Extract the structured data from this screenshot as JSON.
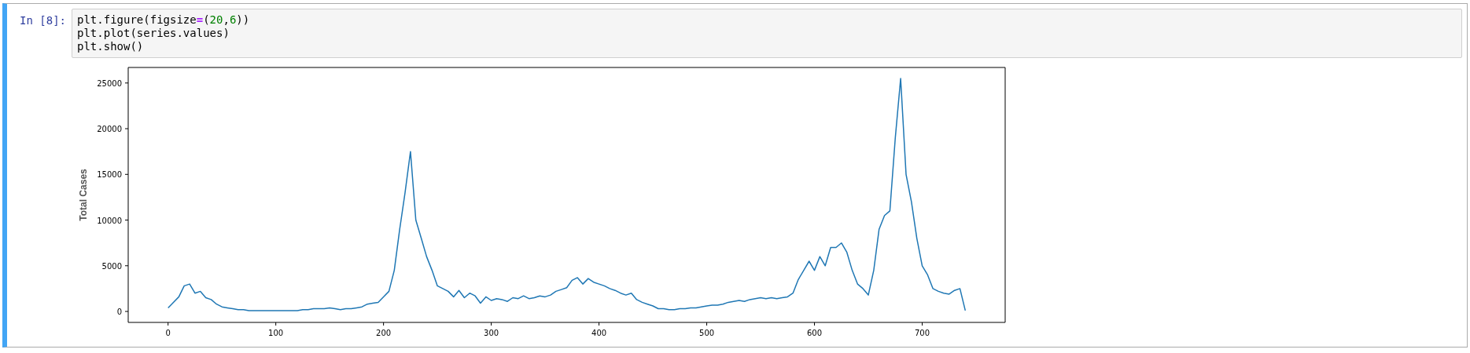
{
  "cell": {
    "prompt": "In [8]:",
    "code_lines": [
      [
        {
          "text": "plt.figure(figsize",
          "kind": "plain"
        },
        {
          "text": "=",
          "kind": "operator"
        },
        {
          "text": "(",
          "kind": "plain"
        },
        {
          "text": "20",
          "kind": "number"
        },
        {
          "text": ",",
          "kind": "plain"
        },
        {
          "text": "6",
          "kind": "number"
        },
        {
          "text": "))",
          "kind": "plain"
        }
      ],
      [
        {
          "text": "plt.plot(series.values)",
          "kind": "plain"
        }
      ],
      [
        {
          "text": "plt.show()",
          "kind": "plain"
        }
      ]
    ],
    "output": {
      "chart_data": {
        "type": "line",
        "ylabel": "Total Cases",
        "xlim": [
          -37,
          777
        ],
        "ylim": [
          -1200,
          26700
        ],
        "xticks": [
          0,
          100,
          200,
          300,
          400,
          500,
          600,
          700
        ],
        "yticks": [
          0,
          5000,
          10000,
          15000,
          20000,
          25000
        ],
        "x": [
          0,
          5,
          10,
          15,
          20,
          25,
          30,
          35,
          40,
          45,
          50,
          55,
          60,
          65,
          70,
          75,
          80,
          85,
          90,
          95,
          100,
          105,
          110,
          115,
          120,
          125,
          130,
          135,
          140,
          145,
          150,
          155,
          160,
          165,
          170,
          175,
          180,
          185,
          190,
          195,
          200,
          205,
          210,
          215,
          220,
          225,
          230,
          235,
          240,
          245,
          250,
          255,
          260,
          265,
          270,
          275,
          280,
          285,
          290,
          295,
          300,
          305,
          310,
          315,
          320,
          325,
          330,
          335,
          340,
          345,
          350,
          355,
          360,
          365,
          370,
          375,
          380,
          385,
          390,
          395,
          400,
          405,
          410,
          415,
          420,
          425,
          430,
          435,
          440,
          445,
          450,
          455,
          460,
          465,
          470,
          475,
          480,
          485,
          490,
          495,
          500,
          505,
          510,
          515,
          520,
          525,
          530,
          535,
          540,
          545,
          550,
          555,
          560,
          565,
          570,
          575,
          580,
          585,
          590,
          595,
          600,
          605,
          610,
          615,
          620,
          625,
          630,
          635,
          640,
          645,
          650,
          655,
          660,
          665,
          670,
          675,
          680,
          685,
          690,
          695,
          700,
          705,
          710,
          715,
          720,
          725,
          730,
          735,
          740
        ],
        "series": [
          {
            "color": "#1f77b4",
            "values": [
              400,
              1000,
              1600,
              2800,
              3000,
              2000,
              2200,
              1500,
              1300,
              800,
              500,
              400,
              300,
              200,
              200,
              100,
              100,
              100,
              100,
              100,
              100,
              100,
              100,
              100,
              100,
              200,
              200,
              300,
              300,
              300,
              400,
              300,
              200,
              300,
              300,
              400,
              500,
              800,
              900,
              1000,
              1600,
              2200,
              4500,
              9000,
              13000,
              17500,
              10000,
              8000,
              6000,
              4500,
              2800,
              2500,
              2200,
              1600,
              2300,
              1500,
              2000,
              1700,
              900,
              1600,
              1200,
              1400,
              1300,
              1100,
              1500,
              1400,
              1700,
              1400,
              1500,
              1700,
              1600,
              1800,
              2200,
              2400,
              2600,
              3400,
              3700,
              3000,
              3600,
              3200,
              3000,
              2800,
              2500,
              2300,
              2000,
              1800,
              2000,
              1300,
              1000,
              800,
              600,
              300,
              300,
              200,
              200,
              300,
              300,
              400,
              400,
              500,
              600,
              700,
              700,
              800,
              1000,
              1100,
              1200,
              1100,
              1300,
              1400,
              1500,
              1400,
              1500,
              1400,
              1500,
              1600,
              2000,
              3500,
              4500,
              5500,
              4500,
              6000,
              5000,
              7000,
              7000,
              7500,
              6500,
              4500,
              3000,
              2500,
              1800,
              4500,
              9000,
              10500,
              11000,
              19000,
              25500,
              15000,
              12000,
              8000,
              5000,
              4000,
              2500,
              2200,
              2000,
              1900,
              2300,
              2500,
              100
            ]
          }
        ]
      }
    }
  }
}
